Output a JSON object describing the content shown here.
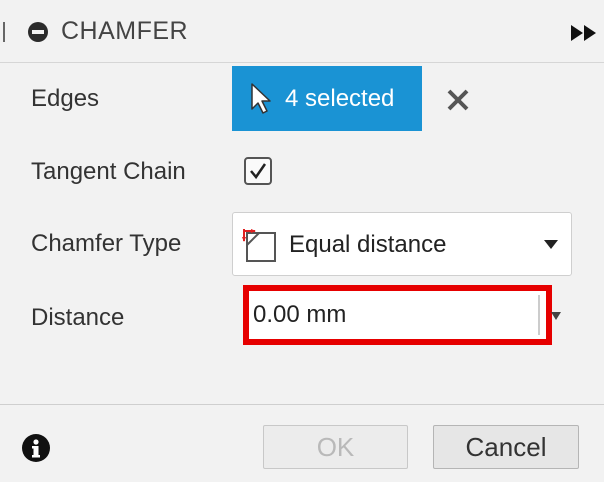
{
  "header": {
    "title": "CHAMFER",
    "icons": {
      "collapse": "minus-circle-icon",
      "expand": "fast-forward-icon"
    }
  },
  "edges": {
    "label": "Edges",
    "selection_text": "4 selected",
    "icon": "cursor-arrow-icon",
    "clear_icon": "x-icon"
  },
  "tangent_chain": {
    "label": "Tangent Chain",
    "checked": true
  },
  "chamfer_type": {
    "label": "Chamfer Type",
    "value": "Equal distance",
    "icon": "equal-distance-chamfer-icon"
  },
  "distance": {
    "label": "Distance",
    "value": "0.00 mm"
  },
  "footer": {
    "ok_label": "OK",
    "cancel_label": "Cancel",
    "info_icon": "info-icon"
  },
  "colors": {
    "accent": "#1a93d4",
    "highlight": "#e60000",
    "background": "#f2f2f2"
  }
}
